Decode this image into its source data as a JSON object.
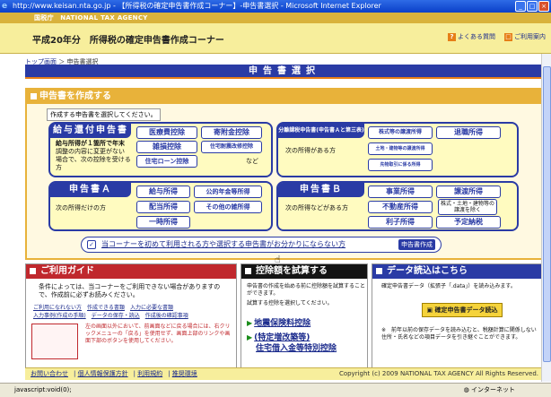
{
  "window": {
    "title": "http://www.keisan.nta.go.jp - 【所得税の確定申告書作成コーナー】-申告書選択 - Microsoft Internet Explorer"
  },
  "header": {
    "agency": "国税庁　NATIONAL TAX AGENCY",
    "page_title": "平成20年分　所得税の確定申告書作成コーナー",
    "faq": "よくある質問",
    "guide": "ご利用案内"
  },
  "breadcrumb": {
    "top": "トップ画面",
    "sep": "＞",
    "current": "申告書選択"
  },
  "banner": "申告書選択",
  "create": {
    "heading": "申告書を作成する",
    "sub": "作成する申告書を選択してください。",
    "kyuyo": {
      "title": "給与還付申告書",
      "desc1": "給与所得が１箇所で年末",
      "desc2": "調整の内容に変更がない",
      "desc3": "場合で、次の控除を受ける",
      "desc4": "方",
      "buttons": [
        "医療費控除",
        "寄附金控除",
        "雑損控除",
        "住宅耐震改修控除",
        "住宅ローン控除"
      ],
      "nado": "など"
    },
    "bunri": {
      "title": "分離課税申告書(申告書Ａと第三表)",
      "desc": "次の所得がある方",
      "buttons": [
        "株式等の譲渡所得",
        "退職所得",
        "土地・建物等の譲渡所得",
        "先物取引に係る所得"
      ]
    },
    "a": {
      "title": "申告書Ａ",
      "desc": "次の所得だけの方",
      "buttons": [
        "給与所得",
        "公的年金等所得",
        "配当所得",
        "その他の雑所得",
        "一時所得"
      ]
    },
    "b": {
      "title": "申告書Ｂ",
      "desc": "次の所得などがある方",
      "buttons": [
        "事業所得",
        "譲渡所得",
        "不動産所得",
        "株式・土地・建物等の譲渡を除く",
        "利子所得",
        "予定納税"
      ]
    },
    "note_link": "当コーナーを初めて利用される方や選択する申告書がお分かりにならない方",
    "note_badge": "申告書作成"
  },
  "guide": {
    "heading": "ご利用ガイド",
    "intro": "条件によっては、当コーナーをご利用できない場合がありますので、作成前に必ずお読みください。",
    "links": [
      "ご利用になれない方",
      "作成できる書類",
      "入力に必要な書類",
      "入力事例(作成の手順)",
      "データの保存・読込",
      "作成後の確認事項"
    ],
    "warn": "左の画面以外において、前画面などに戻る場合には、右クリックメニューの「戻る」を使用せず、画面上部のリンクや画面下部のボタンを使用してください。"
  },
  "calc": {
    "heading": "控除額を試算する",
    "intro": "申告書の作成を始める前に控除額を試算することができます。",
    "intro2": "試算する控除を選択してください。",
    "link1": "地震保険料控除",
    "link2a": "(特定増改築等)",
    "link2b": "住宅借入金等特別控除"
  },
  "data": {
    "heading": "データ読込はこちら",
    "intro": "確定申告書データ（拡張子「.data」）を読み込みます。",
    "button": "確定申告書データ読込",
    "note": "※　前年以前の保存データを読み込むと、税額計算に関係しない住所・氏名などの項目データを引き継ぐことができます。"
  },
  "footer": {
    "links": [
      "お問い合わせ",
      "個人情報保護方針",
      "利用規約",
      "推奨環境"
    ],
    "copy": "Copyright (c) 2009 NATIONAL TAX AGENCY All Rights Reserved."
  },
  "status": {
    "left": "javascript:void(0);",
    "zone": "インターネット"
  }
}
